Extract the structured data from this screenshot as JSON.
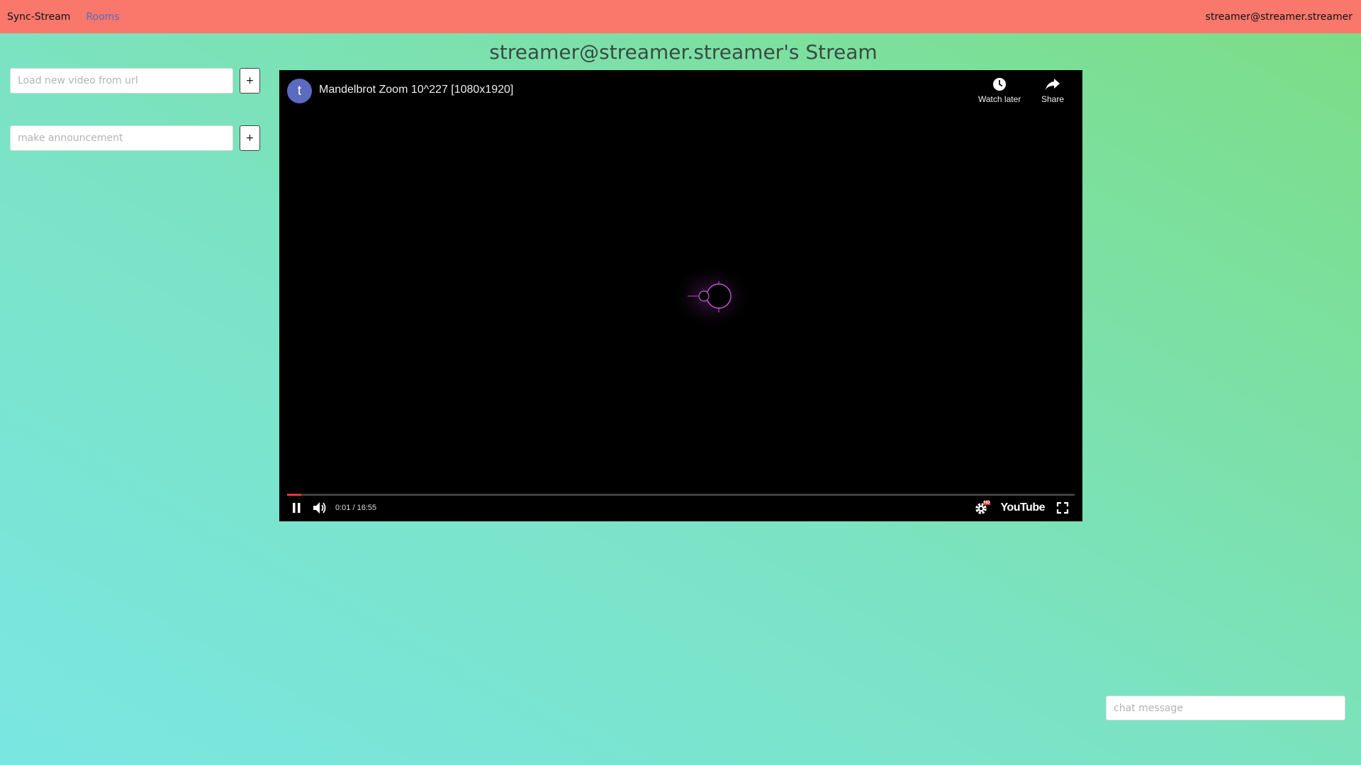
{
  "navbar": {
    "brand": "Sync-Stream",
    "rooms_link": "Rooms",
    "user": "streamer@streamer.streamer"
  },
  "page": {
    "title": "streamer@streamer.streamer's Stream"
  },
  "sidebar": {
    "video_url_placeholder": "Load new video from url",
    "video_url_value": "",
    "announcement_placeholder": "make announcement",
    "announcement_value": "",
    "add_label": "+"
  },
  "player": {
    "channel_initial": "t",
    "video_title": "Mandelbrot Zoom 10^227 [1080x1920]",
    "watch_later_label": "Watch later",
    "share_label": "Share",
    "time_display": "0:01 / 16:55",
    "progress_fraction": 0.001,
    "logo_text": "YouTube",
    "quality_badge": "HD",
    "icons": [
      "clock-icon",
      "share-arrow-icon",
      "pause-icon",
      "volume-icon",
      "settings-gear-icon",
      "fullscreen-icon"
    ]
  },
  "chat": {
    "message_placeholder": "chat message",
    "message_value": ""
  },
  "colors": {
    "navbar": "#f9776b",
    "avatar": "#5c6bc0",
    "progress": "#e53935"
  }
}
